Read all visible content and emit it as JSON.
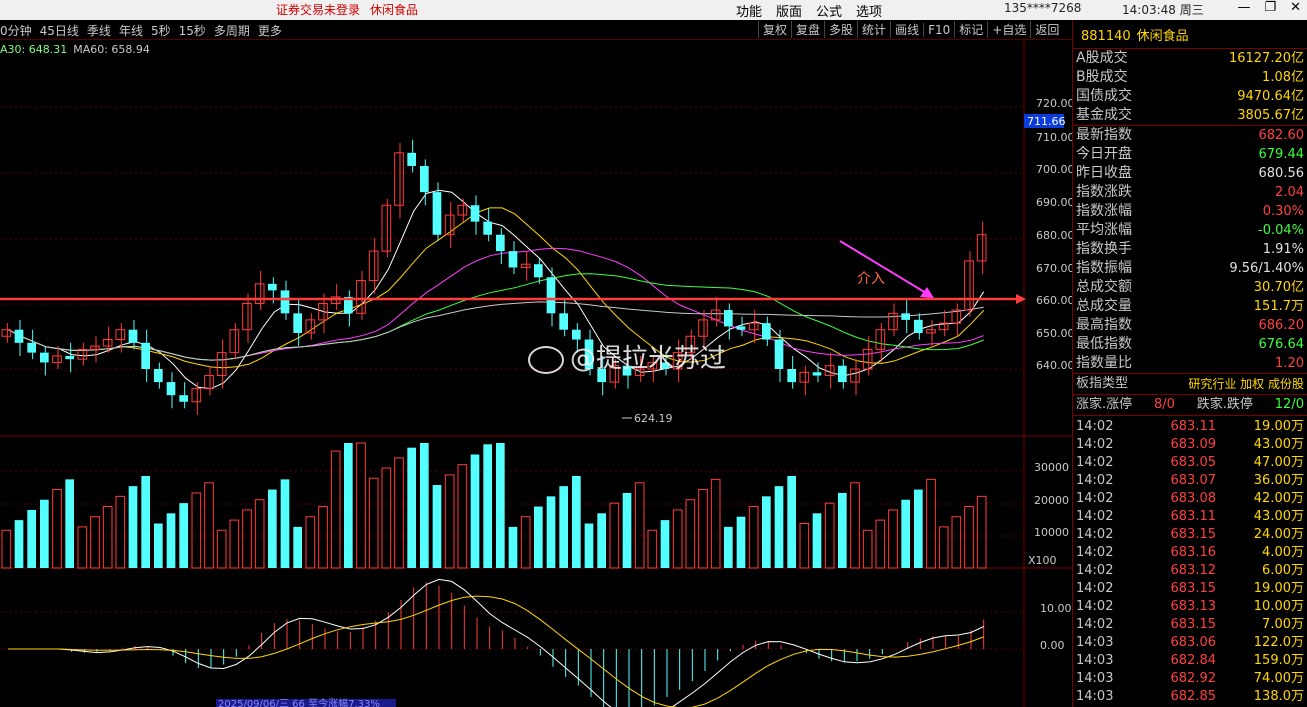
{
  "titlebar": {
    "warning": "证券交易未登录",
    "warning_name": "休闲食品",
    "menu": [
      "功能",
      "版面",
      "公式",
      "选项"
    ],
    "user": "135****7268",
    "clock": "14:03:48 周三",
    "min": "—",
    "max": "❐",
    "close": "✕"
  },
  "toolbar": {
    "periods": [
      "0分钟",
      "45日线",
      "季线",
      "年线",
      "5秒",
      "15秒",
      "多周期",
      "更多"
    ],
    "tools": [
      "复权",
      "复盘",
      "多股",
      "统计",
      "画线",
      "F10",
      "标记",
      "+自选",
      "返回"
    ]
  },
  "ma": {
    "ma30": "A30: 648.31",
    "ma60": "MA60: 658.94"
  },
  "chart_labels": {
    "price_ticks": [
      "720.00",
      "710.00",
      "700.00",
      "690.00",
      "680.00",
      "670.00",
      "660.00",
      "650.00",
      "640.00"
    ],
    "current_price": "711.66",
    "low_mark": "624.19",
    "annotation": "介入",
    "vol_ticks": [
      "30000",
      "20000",
      "10000"
    ],
    "vol_unit": "X100",
    "macd_ticks": [
      "10.00",
      "0.00"
    ],
    "bottom_date": "2025/09/06/三 66 至今涨幅7.33%"
  },
  "watermark": "@提拉米苏过",
  "panel": {
    "code": "881140",
    "name": "休闲食品",
    "stats_top": [
      {
        "label": "A股成交",
        "value": "16127.20亿",
        "color": "#ffd700"
      },
      {
        "label": "B股成交",
        "value": "1.08亿",
        "color": "#ffd700"
      },
      {
        "label": "国债成交",
        "value": "9470.64亿",
        "color": "#ffd700"
      },
      {
        "label": "基金成交",
        "value": "3805.67亿",
        "color": "#ffd700"
      }
    ],
    "stats": [
      {
        "label": "最新指数",
        "value": "682.60",
        "color": "#ff4040"
      },
      {
        "label": "今日开盘",
        "value": "679.44",
        "color": "#3cff3c"
      },
      {
        "label": "昨日收盘",
        "value": "680.56",
        "color": "#e0e0e0"
      },
      {
        "label": "指数涨跌",
        "value": "2.04",
        "color": "#ff4040"
      },
      {
        "label": "指数涨幅",
        "value": "0.30%",
        "color": "#ff4040"
      },
      {
        "label": "平均涨幅",
        "value": "-0.04%",
        "color": "#3cff3c"
      },
      {
        "label": "指数换手",
        "value": "1.91%",
        "color": "#e0e0e0"
      },
      {
        "label": "指数振幅",
        "value": "9.56/1.40%",
        "color": "#e0e0e0"
      },
      {
        "label": "总成交额",
        "value": "30.70亿",
        "color": "#ffd700"
      },
      {
        "label": "总成交量",
        "value": "151.7万",
        "color": "#ffd700"
      },
      {
        "label": "最高指数",
        "value": "686.20",
        "color": "#ff4040"
      },
      {
        "label": "最低指数",
        "value": "676.64",
        "color": "#3cff3c"
      },
      {
        "label": "指数量比",
        "value": "1.20",
        "color": "#ff4040"
      }
    ],
    "board_type_label": "板指类型",
    "board_type_value": "研究行业 加权 成份股",
    "rise_label": "涨家.涨停",
    "rise_value": "8/0",
    "fall_label": "跌家.跌停",
    "fall_value": "12/0",
    "ticks": [
      {
        "t": "14:02",
        "p": "683.11",
        "v": "19.00万"
      },
      {
        "t": "14:02",
        "p": "683.09",
        "v": "43.00万"
      },
      {
        "t": "14:02",
        "p": "683.05",
        "v": "47.00万"
      },
      {
        "t": "14:02",
        "p": "683.07",
        "v": "36.00万"
      },
      {
        "t": "14:02",
        "p": "683.08",
        "v": "42.00万"
      },
      {
        "t": "14:02",
        "p": "683.11",
        "v": "43.00万"
      },
      {
        "t": "14:02",
        "p": "683.15",
        "v": "24.00万"
      },
      {
        "t": "14:02",
        "p": "683.16",
        "v": "4.00万"
      },
      {
        "t": "14:02",
        "p": "683.12",
        "v": "6.00万"
      },
      {
        "t": "14:02",
        "p": "683.15",
        "v": "19.00万"
      },
      {
        "t": "14:02",
        "p": "683.13",
        "v": "10.00万"
      },
      {
        "t": "14:02",
        "p": "683.15",
        "v": "7.00万"
      },
      {
        "t": "14:03",
        "p": "683.06",
        "v": "122.0万"
      },
      {
        "t": "14:03",
        "p": "682.84",
        "v": "159.0万"
      },
      {
        "t": "14:03",
        "p": "682.92",
        "v": "74.00万"
      },
      {
        "t": "14:03",
        "p": "682.85",
        "v": "138.0万"
      }
    ]
  },
  "colors": {
    "up": "#ff3c3c",
    "down": "#54ffff",
    "accent": "#ffd700"
  }
}
